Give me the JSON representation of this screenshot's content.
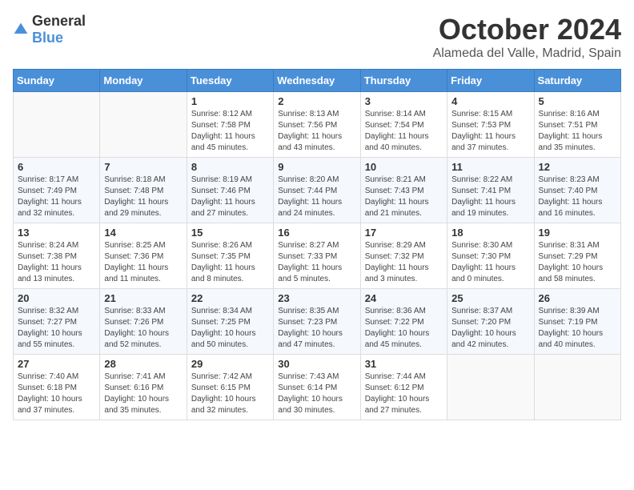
{
  "header": {
    "logo_general": "General",
    "logo_blue": "Blue",
    "month_year": "October 2024",
    "location": "Alameda del Valle, Madrid, Spain"
  },
  "weekdays": [
    "Sunday",
    "Monday",
    "Tuesday",
    "Wednesday",
    "Thursday",
    "Friday",
    "Saturday"
  ],
  "weeks": [
    [
      {
        "day": "",
        "detail": ""
      },
      {
        "day": "",
        "detail": ""
      },
      {
        "day": "1",
        "detail": "Sunrise: 8:12 AM\nSunset: 7:58 PM\nDaylight: 11 hours and 45 minutes."
      },
      {
        "day": "2",
        "detail": "Sunrise: 8:13 AM\nSunset: 7:56 PM\nDaylight: 11 hours and 43 minutes."
      },
      {
        "day": "3",
        "detail": "Sunrise: 8:14 AM\nSunset: 7:54 PM\nDaylight: 11 hours and 40 minutes."
      },
      {
        "day": "4",
        "detail": "Sunrise: 8:15 AM\nSunset: 7:53 PM\nDaylight: 11 hours and 37 minutes."
      },
      {
        "day": "5",
        "detail": "Sunrise: 8:16 AM\nSunset: 7:51 PM\nDaylight: 11 hours and 35 minutes."
      }
    ],
    [
      {
        "day": "6",
        "detail": "Sunrise: 8:17 AM\nSunset: 7:49 PM\nDaylight: 11 hours and 32 minutes."
      },
      {
        "day": "7",
        "detail": "Sunrise: 8:18 AM\nSunset: 7:48 PM\nDaylight: 11 hours and 29 minutes."
      },
      {
        "day": "8",
        "detail": "Sunrise: 8:19 AM\nSunset: 7:46 PM\nDaylight: 11 hours and 27 minutes."
      },
      {
        "day": "9",
        "detail": "Sunrise: 8:20 AM\nSunset: 7:44 PM\nDaylight: 11 hours and 24 minutes."
      },
      {
        "day": "10",
        "detail": "Sunrise: 8:21 AM\nSunset: 7:43 PM\nDaylight: 11 hours and 21 minutes."
      },
      {
        "day": "11",
        "detail": "Sunrise: 8:22 AM\nSunset: 7:41 PM\nDaylight: 11 hours and 19 minutes."
      },
      {
        "day": "12",
        "detail": "Sunrise: 8:23 AM\nSunset: 7:40 PM\nDaylight: 11 hours and 16 minutes."
      }
    ],
    [
      {
        "day": "13",
        "detail": "Sunrise: 8:24 AM\nSunset: 7:38 PM\nDaylight: 11 hours and 13 minutes."
      },
      {
        "day": "14",
        "detail": "Sunrise: 8:25 AM\nSunset: 7:36 PM\nDaylight: 11 hours and 11 minutes."
      },
      {
        "day": "15",
        "detail": "Sunrise: 8:26 AM\nSunset: 7:35 PM\nDaylight: 11 hours and 8 minutes."
      },
      {
        "day": "16",
        "detail": "Sunrise: 8:27 AM\nSunset: 7:33 PM\nDaylight: 11 hours and 5 minutes."
      },
      {
        "day": "17",
        "detail": "Sunrise: 8:29 AM\nSunset: 7:32 PM\nDaylight: 11 hours and 3 minutes."
      },
      {
        "day": "18",
        "detail": "Sunrise: 8:30 AM\nSunset: 7:30 PM\nDaylight: 11 hours and 0 minutes."
      },
      {
        "day": "19",
        "detail": "Sunrise: 8:31 AM\nSunset: 7:29 PM\nDaylight: 10 hours and 58 minutes."
      }
    ],
    [
      {
        "day": "20",
        "detail": "Sunrise: 8:32 AM\nSunset: 7:27 PM\nDaylight: 10 hours and 55 minutes."
      },
      {
        "day": "21",
        "detail": "Sunrise: 8:33 AM\nSunset: 7:26 PM\nDaylight: 10 hours and 52 minutes."
      },
      {
        "day": "22",
        "detail": "Sunrise: 8:34 AM\nSunset: 7:25 PM\nDaylight: 10 hours and 50 minutes."
      },
      {
        "day": "23",
        "detail": "Sunrise: 8:35 AM\nSunset: 7:23 PM\nDaylight: 10 hours and 47 minutes."
      },
      {
        "day": "24",
        "detail": "Sunrise: 8:36 AM\nSunset: 7:22 PM\nDaylight: 10 hours and 45 minutes."
      },
      {
        "day": "25",
        "detail": "Sunrise: 8:37 AM\nSunset: 7:20 PM\nDaylight: 10 hours and 42 minutes."
      },
      {
        "day": "26",
        "detail": "Sunrise: 8:39 AM\nSunset: 7:19 PM\nDaylight: 10 hours and 40 minutes."
      }
    ],
    [
      {
        "day": "27",
        "detail": "Sunrise: 7:40 AM\nSunset: 6:18 PM\nDaylight: 10 hours and 37 minutes."
      },
      {
        "day": "28",
        "detail": "Sunrise: 7:41 AM\nSunset: 6:16 PM\nDaylight: 10 hours and 35 minutes."
      },
      {
        "day": "29",
        "detail": "Sunrise: 7:42 AM\nSunset: 6:15 PM\nDaylight: 10 hours and 32 minutes."
      },
      {
        "day": "30",
        "detail": "Sunrise: 7:43 AM\nSunset: 6:14 PM\nDaylight: 10 hours and 30 minutes."
      },
      {
        "day": "31",
        "detail": "Sunrise: 7:44 AM\nSunset: 6:12 PM\nDaylight: 10 hours and 27 minutes."
      },
      {
        "day": "",
        "detail": ""
      },
      {
        "day": "",
        "detail": ""
      }
    ]
  ]
}
